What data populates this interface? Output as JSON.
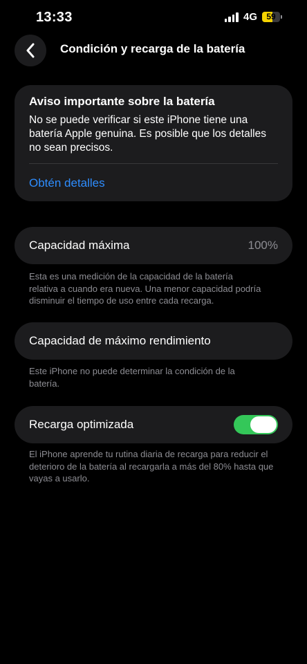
{
  "status_bar": {
    "time": "13:33",
    "network": "4G",
    "battery_level": "59",
    "battery_fraction": 0.59,
    "signal_bars": 4
  },
  "nav": {
    "title": "Condición y recarga de la batería",
    "back_icon": "chevron-left-icon"
  },
  "notice": {
    "title": "Aviso importante sobre la batería",
    "body": "No se puede verificar si este iPhone tiene una batería Apple genuina. Es posible que los detalles no sean precisos.",
    "link": "Obtén detalles"
  },
  "max_capacity": {
    "label": "Capacidad máxima",
    "value": "100%",
    "footnote": "Esta es una medición de la capacidad de la batería relativa a cuando era nueva. Una menor capacidad podría disminuir el tiempo de uso entre cada recarga."
  },
  "peak_performance": {
    "label": "Capacidad de máximo rendimiento",
    "footnote": "Este iPhone no puede determinar la condición de la batería."
  },
  "optimized_charging": {
    "label": "Recarga optimizada",
    "enabled": true,
    "footnote": "El iPhone aprende tu rutina diaria de recarga para reducir el deterioro de la batería al recargarla a más del 80% hasta que vayas a usarlo."
  },
  "colors": {
    "background": "#000000",
    "card": "#1c1c1e",
    "link": "#2e8dfe",
    "toggle_on": "#34c759",
    "secondary_text": "#8d8d93",
    "battery_fill": "#f5d300"
  }
}
